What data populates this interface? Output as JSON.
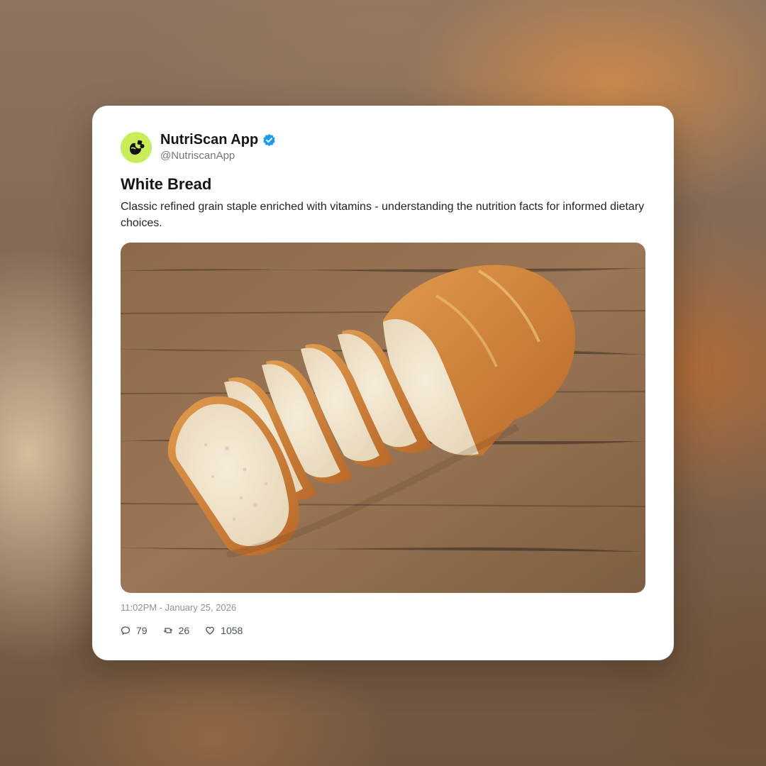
{
  "post": {
    "author": {
      "display_name": "NutriScan App",
      "handle": "@NutriscanApp",
      "verified": true,
      "avatar_icon": "leaf-logo-icon",
      "avatar_color": "#c9ec5a"
    },
    "title": "White Bread",
    "body": "Classic refined grain staple enriched with vitamins - understanding the nutrition facts for informed dietary choices.",
    "image": {
      "subject": "sliced white bread loaf on wooden table"
    },
    "timestamp": "11:02PM - January 25, 2026",
    "stats": {
      "replies": "79",
      "reposts": "26",
      "likes": "1058"
    },
    "icons": {
      "replies": "reply-icon",
      "reposts": "repost-icon",
      "likes": "heart-icon",
      "verified": "verified-badge-icon"
    }
  },
  "colors": {
    "card_background": "#ffffff",
    "verified_blue": "#1d9bf0",
    "text_primary": "#14171a",
    "text_secondary": "#6e7780"
  }
}
